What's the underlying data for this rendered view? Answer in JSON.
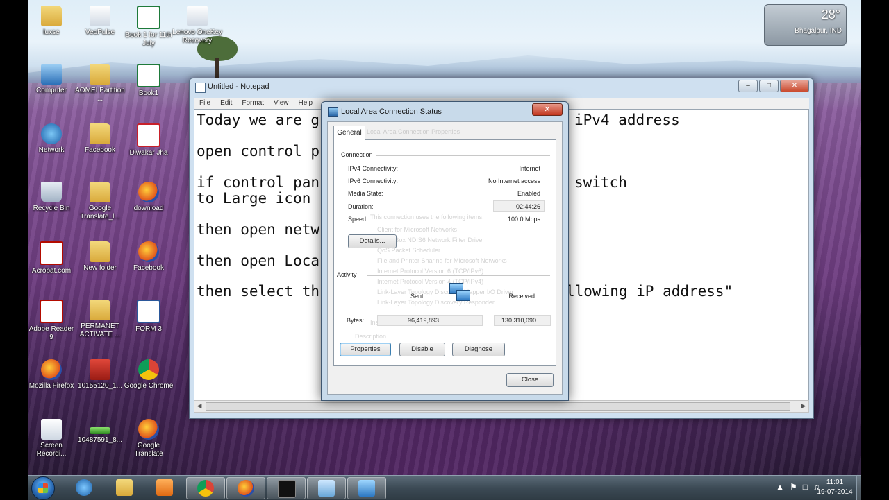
{
  "desktop_icons": [
    {
      "label": "luxse",
      "glyph": "g-folder"
    },
    {
      "label": "VeoPulse",
      "glyph": "g-gen"
    },
    {
      "label": "Book 1 for 11th July",
      "glyph": "g-excel"
    },
    {
      "label": "Lenovo OneKey Recovery",
      "glyph": "g-gen"
    },
    {
      "label": "Computer",
      "glyph": "g-pc"
    },
    {
      "label": "AOMEI Partition ...",
      "glyph": "g-folder"
    },
    {
      "label": "Book1",
      "glyph": "g-excel"
    },
    {
      "label": "Network",
      "glyph": "g-net"
    },
    {
      "label": "Facebook",
      "glyph": "g-folder"
    },
    {
      "label": "Diwakar Jha",
      "glyph": "g-pdf"
    },
    {
      "label": "Recycle Bin",
      "glyph": "g-bin"
    },
    {
      "label": "Google Translate_l...",
      "glyph": "g-folder"
    },
    {
      "label": "download",
      "glyph": "g-ff"
    },
    {
      "label": "Acrobat.com",
      "glyph": "g-acro"
    },
    {
      "label": "New folder",
      "glyph": "g-folder"
    },
    {
      "label": "Facebook",
      "glyph": "g-ff"
    },
    {
      "label": "Adobe Reader 9",
      "glyph": "g-acro"
    },
    {
      "label": "PERMANET ACTIVATE ...",
      "glyph": "g-folder"
    },
    {
      "label": "FORM 3",
      "glyph": "g-word"
    },
    {
      "label": "Mozilla Firefox",
      "glyph": "g-ff"
    },
    {
      "label": "10155120_1...",
      "glyph": "g-red"
    },
    {
      "label": "Google Chrome",
      "glyph": "g-chrome"
    },
    {
      "label": "Screen Recordi...",
      "glyph": "g-gen"
    },
    {
      "label": "10487591_8...",
      "glyph": "g-green"
    },
    {
      "label": "Google Translate",
      "glyph": "g-ff"
    }
  ],
  "weather": {
    "temp": "28°",
    "city": "Bhagalpur, IND"
  },
  "notepad": {
    "title": "Untitled - Notepad",
    "menu": [
      "File",
      "Edit",
      "Format",
      "View",
      "Help"
    ],
    "lines": [
      "Today we are g",
      "open control p",
      "if control pan",
      "to Large icon",
      "then open netw",
      "then open Loca",
      "then select th"
    ],
    "right_fragments": [
      "iPv4 address",
      "switch",
      "llowing iP address\""
    ]
  },
  "dialog": {
    "title": "Local Area Connection Status",
    "tab": "General",
    "connection_label": "Connection",
    "rows": [
      {
        "label": "IPv4 Connectivity:",
        "value": "Internet"
      },
      {
        "label": "IPv6 Connectivity:",
        "value": "No Internet access"
      },
      {
        "label": "Media State:",
        "value": "Enabled"
      },
      {
        "label": "Duration:",
        "value": "02:44:26"
      },
      {
        "label": "Speed:",
        "value": "100.0 Mbps"
      }
    ],
    "details_button": "Details...",
    "activity_label": "Activity",
    "sent_label": "Sent",
    "received_label": "Received",
    "bytes_label": "Bytes:",
    "bytes_sent": "96,419,893",
    "bytes_received": "130,310,090",
    "properties_button": "Properties",
    "disable_button": "Disable",
    "diagnose_button": "Diagnose",
    "close_button": "Close",
    "close_x": "✕",
    "ghost_lines": [
      "Local Area Connection Properties",
      "This connection uses the following items:",
      "Client for Microsoft Networks",
      "VirtualBox NDIS6 Network Filter Driver",
      "QoS Packet Scheduler",
      "File and Printer Sharing for Microsoft Networks",
      "Internet Protocol Version 6 (TCP/IPv6)",
      "Internet Protocol Version 4 (TCP/IPv4)",
      "Link-Layer Topology Discovery Mapper I/O Driver",
      "Link-Layer Topology Discovery Responder",
      "Install...",
      "Description"
    ]
  },
  "taskbar": {
    "buttons": [
      "internet-explorer",
      "file-explorer",
      "media-player",
      "chrome",
      "firefox",
      "command-prompt",
      "notepad",
      "network-status"
    ],
    "clock_time": "11:01",
    "clock_date": "19-07-2014"
  }
}
